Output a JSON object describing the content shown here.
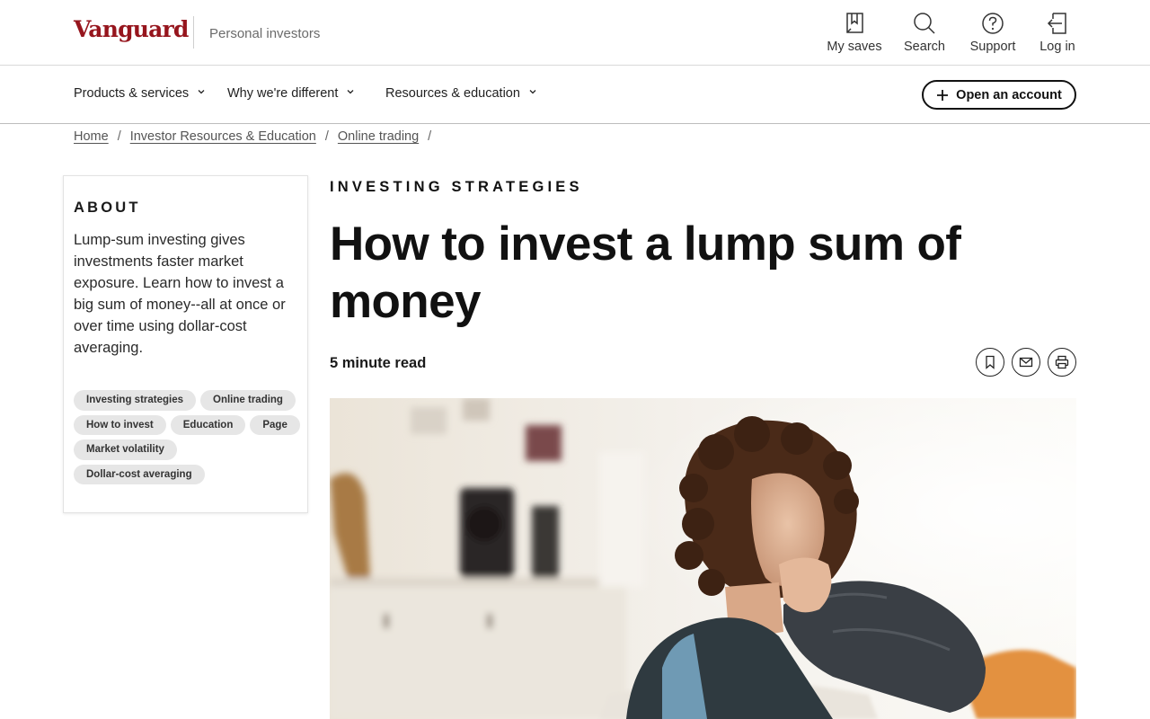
{
  "header": {
    "logo_text": "Vanguard",
    "segment": "Personal investors",
    "utilities": [
      {
        "label": "My saves",
        "icon": "bookmark-icon"
      },
      {
        "label": "Search",
        "icon": "search-icon"
      },
      {
        "label": "Support",
        "icon": "help-icon"
      },
      {
        "label": "Log in",
        "icon": "login-icon"
      }
    ]
  },
  "nav": {
    "items": [
      {
        "label": "Products & services"
      },
      {
        "label": "Why we're different"
      },
      {
        "label": "Resources & education"
      }
    ],
    "cta_label": "Open an account"
  },
  "breadcrumb": {
    "items": [
      "Home",
      "Investor Resources & Education",
      "Online trading"
    ],
    "separator": "/"
  },
  "about": {
    "heading": "ABOUT",
    "summary": "Lump-sum investing gives investments faster market exposure. Learn how to invest a big sum of money--all at once or over time using dollar-cost averaging.",
    "tags": [
      "Investing strategies",
      "Online trading",
      "How to invest",
      "Education",
      "Page",
      "Market volatility",
      "Dollar-cost averaging"
    ]
  },
  "article": {
    "kicker": "INVESTING STRATEGIES",
    "title": "How to invest a lump sum of money",
    "read_time": "5 minute read",
    "actions": [
      {
        "icon": "bookmark-icon"
      },
      {
        "icon": "email-icon"
      },
      {
        "icon": "print-icon"
      }
    ]
  },
  "colors": {
    "brand": "#96151d",
    "text": "#111111",
    "tag_bg": "#e6e6e6"
  }
}
